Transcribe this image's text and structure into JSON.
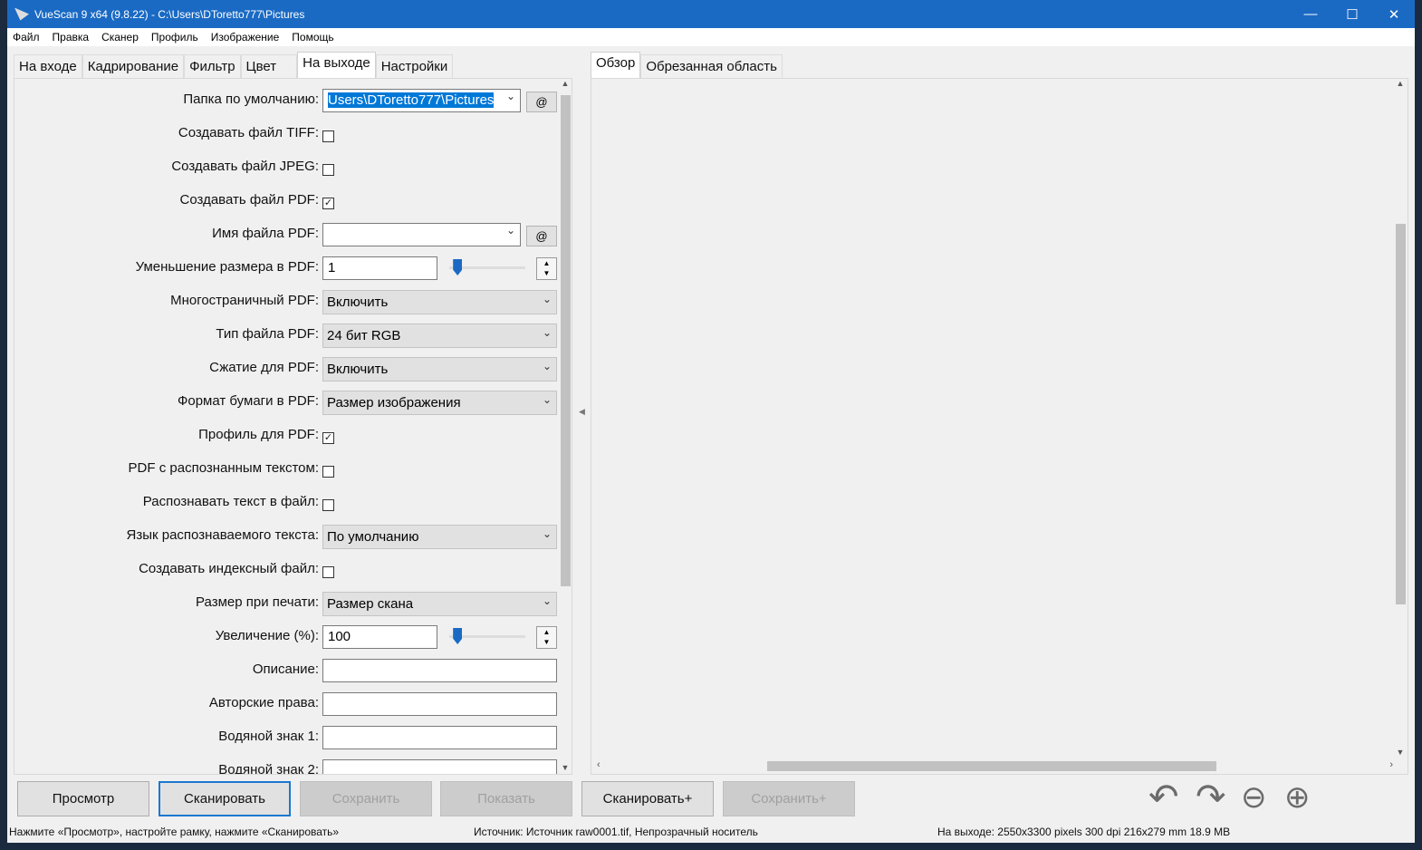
{
  "title": "VueScan 9 x64 (9.8.22) - C:\\Users\\DToretto777\\Pictures",
  "menu": [
    "Файл",
    "Правка",
    "Сканер",
    "Профиль",
    "Изображение",
    "Помощь"
  ],
  "left_tabs": [
    "На входе",
    "Кадрирование",
    "Фильтр",
    "Цвет",
    "На выходе",
    "Настройки"
  ],
  "right_tabs": [
    "Обзор",
    "Обрезанная область"
  ],
  "rows": [
    {
      "type": "combo",
      "label": "Папка по умолчанию:",
      "value": "Users\\DToretto777\\Pictures",
      "selected": true,
      "at": "@"
    },
    {
      "type": "check",
      "label": "Создавать файл TIFF:",
      "checked": false
    },
    {
      "type": "check",
      "label": "Создавать файл JPEG:",
      "checked": false
    },
    {
      "type": "check",
      "label": "Создавать файл PDF:",
      "checked": true
    },
    {
      "type": "combo",
      "label": "Имя файла PDF:",
      "value": "",
      "at": "@"
    },
    {
      "type": "slider",
      "label": "Уменьшение размера в PDF:",
      "value": "1",
      "level": 0.05
    },
    {
      "type": "select",
      "label": "Многостраничный PDF:",
      "value": "Включить"
    },
    {
      "type": "select",
      "label": "Тип файла PDF:",
      "value": "24 бит RGB"
    },
    {
      "type": "select",
      "label": "Сжатие для PDF:",
      "value": "Включить"
    },
    {
      "type": "select",
      "label": "Формат бумаги в PDF:",
      "value": "Размер изображения"
    },
    {
      "type": "check",
      "label": "Профиль для PDF:",
      "checked": true
    },
    {
      "type": "check",
      "label": "PDF с распознанным текстом:",
      "checked": false
    },
    {
      "type": "check",
      "label": "Распознавать текст в файл:",
      "checked": false
    },
    {
      "type": "select",
      "label": "Язык распознаваемого текста:",
      "value": "По умолчанию"
    },
    {
      "type": "check",
      "label": "Создавать индексный файл:",
      "checked": false
    },
    {
      "type": "select",
      "label": "Размер при печати:",
      "value": "Размер скана"
    },
    {
      "type": "slider",
      "label": "Увеличение (%):",
      "value": "100",
      "level": 0.05
    },
    {
      "type": "text",
      "label": "Описание:",
      "value": ""
    },
    {
      "type": "text",
      "label": "Авторские права:",
      "value": ""
    },
    {
      "type": "text",
      "label": "Водяной знак 1:",
      "value": ""
    },
    {
      "type": "text",
      "label": "Водяной знак 2:",
      "value": ""
    }
  ],
  "buttons": [
    {
      "label": "Просмотр",
      "state": "normal"
    },
    {
      "label": "Сканировать",
      "state": "default"
    },
    {
      "label": "Сохранить",
      "state": "disabled"
    },
    {
      "label": "Показать",
      "state": "disabled"
    },
    {
      "label": "Сканировать+",
      "state": "normal"
    },
    {
      "label": "Сохранить+",
      "state": "disabled"
    }
  ],
  "status": {
    "hint": "Нажмите «Просмотр», настройте рамку, нажмите «Сканировать»",
    "source": "Источник: Источник raw0001.tif, Непрозрачный носитель",
    "output": "На выходе: 2550x3300 pixels 300 dpi 216x279 mm 18.9 MB"
  }
}
